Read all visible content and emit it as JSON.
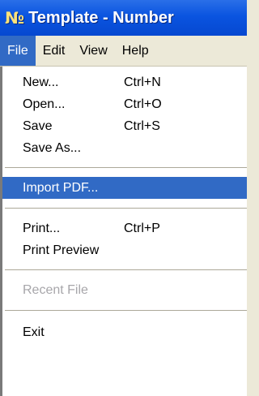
{
  "window": {
    "icon_text": "№",
    "title": "Template - Number"
  },
  "menubar": {
    "items": [
      "File",
      "Edit",
      "View",
      "Help"
    ],
    "active": "File"
  },
  "file_menu": {
    "items": [
      {
        "label": "New...",
        "shortcut": "Ctrl+N"
      },
      {
        "label": "Open...",
        "shortcut": "Ctrl+O"
      },
      {
        "label": "Save",
        "shortcut": "Ctrl+S"
      },
      {
        "label": "Save As...",
        "shortcut": ""
      },
      {
        "label": "Import PDF...",
        "shortcut": "",
        "highlighted": true
      },
      {
        "label": "Print...",
        "shortcut": "Ctrl+P"
      },
      {
        "label": "Print Preview",
        "shortcut": ""
      },
      {
        "label": "Recent File",
        "shortcut": "",
        "disabled": true
      },
      {
        "label": "Exit",
        "shortcut": ""
      }
    ]
  },
  "colors": {
    "titlebar": "#0a54e0",
    "highlight": "#316ac5",
    "menu_bg": "#ece9d8",
    "disabled_text": "#a7a6aa"
  }
}
